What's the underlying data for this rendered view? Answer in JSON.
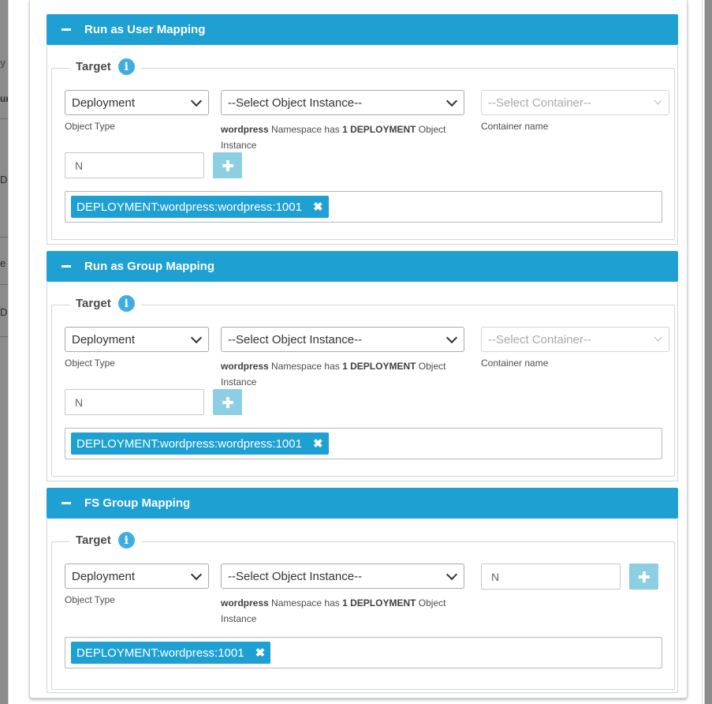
{
  "background": {
    "fragments": [
      "y",
      "ur",
      "D",
      "e",
      "D"
    ]
  },
  "sections": [
    {
      "title": "Run as User Mapping",
      "legend": "Target",
      "object_type": "Deployment",
      "object_type_label": "Object Type",
      "object_instance": "--Select Object Instance--",
      "namespace_note": {
        "ns": "wordpress",
        "mid": "Namespace has",
        "count": "1 DEPLOYMENT",
        "tail": "Object",
        "line2": "Instance"
      },
      "container": "--Select Container--",
      "container_label": "Container name",
      "id_value": "N",
      "tag": "DEPLOYMENT:wordpress:wordpress:1001"
    },
    {
      "title": "Run as Group Mapping",
      "legend": "Target",
      "object_type": "Deployment",
      "object_type_label": "Object Type",
      "object_instance": "--Select Object Instance--",
      "namespace_note": {
        "ns": "wordpress",
        "mid": "Namespace has",
        "count": "1 DEPLOYMENT",
        "tail": "Object",
        "line2": "Instance"
      },
      "container": "--Select Container--",
      "container_label": "Container name",
      "id_value": "N",
      "tag": "DEPLOYMENT:wordpress:wordpress:1001"
    },
    {
      "title": "FS Group Mapping",
      "legend": "Target",
      "object_type": "Deployment",
      "object_type_label": "Object Type",
      "object_instance": "--Select Object Instance--",
      "namespace_note": {
        "ns": "wordpress",
        "mid": "Namespace has",
        "count": "1 DEPLOYMENT",
        "tail": "Object",
        "line2": "Instance"
      },
      "id_value": "N",
      "tag": "DEPLOYMENT:wordpress:1001"
    }
  ],
  "icons": {
    "collapse": "minus-icon",
    "info": "info-icon",
    "add": "plus-icon",
    "remove": "times-icon",
    "dropdown": "chevron-down-icon"
  },
  "colors": {
    "accent": "#1ea0d3",
    "add_button": "#8ccfe3"
  }
}
